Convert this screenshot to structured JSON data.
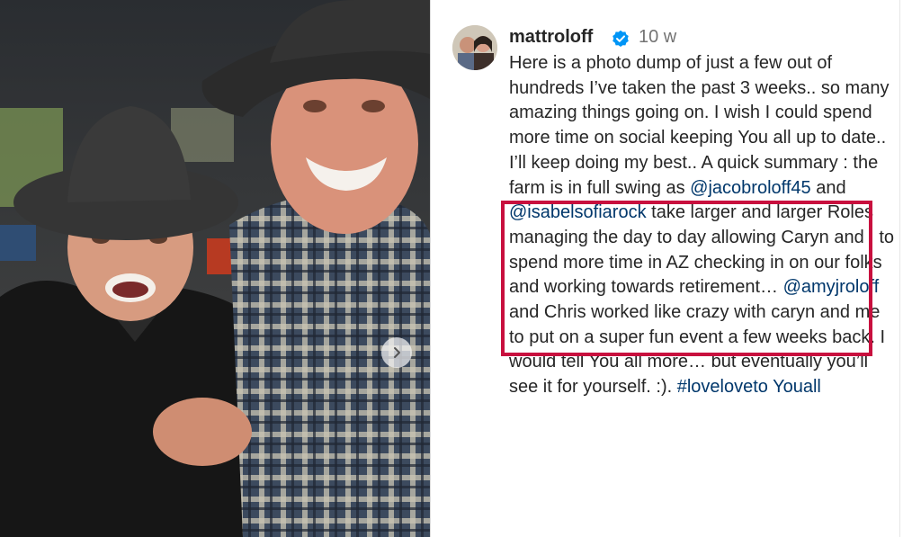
{
  "post": {
    "username": "mattroloff",
    "time_ago": "10 w",
    "caption_parts": [
      {
        "type": "text",
        "text": "Here is a photo dump of just a few out of hundreds I’ve taken the past 3 weeks.. so many amazing things going on. I wish I could spend more time on social keeping You all up to date.. I’ll keep doing my best.. A quick summary : the farm is in full swing as "
      },
      {
        "type": "mention",
        "text": "@jacobroloff45"
      },
      {
        "type": "text",
        "text": " and "
      },
      {
        "type": "mention",
        "text": "@isabelsofiarock"
      },
      {
        "type": "text",
        "text": " take larger and larger Roles managing the day to day allowing Caryn and I to spend more time in AZ checking in on our folks and working towards retirement… "
      },
      {
        "type": "mention",
        "text": "@amyjroloff"
      },
      {
        "type": "text",
        "text": " and Chris worked like crazy with caryn and me to put on a super fun event a few weeks back. I would tell You all more… but eventually you’ll see it for yourself. :). "
      },
      {
        "type": "hashtag",
        "text": "#loveloveto Youall"
      }
    ]
  },
  "icons": {
    "verified": "verified-badge-icon",
    "next": "chevron-right-icon"
  },
  "colors": {
    "highlight": "#c8103e",
    "link": "#00376b",
    "verified": "#0095f6"
  }
}
